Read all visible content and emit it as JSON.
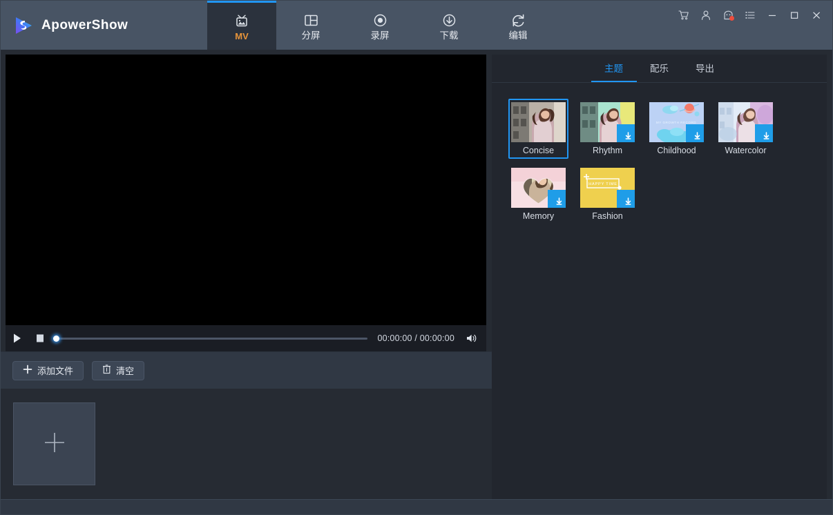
{
  "app": {
    "brand_name": "ApowerShow",
    "logo_icon": "play-logo-icon"
  },
  "nav": {
    "tabs": [
      {
        "label": "MV",
        "icon": "tv-icon",
        "active": true
      },
      {
        "label": "分屏",
        "icon": "split-screen-icon",
        "active": false
      },
      {
        "label": "录屏",
        "icon": "record-icon",
        "active": false
      },
      {
        "label": "下载",
        "icon": "download-icon",
        "active": false
      },
      {
        "label": "编辑",
        "icon": "edit-refresh-icon",
        "active": false
      }
    ]
  },
  "window_controls": [
    {
      "name": "cart-icon",
      "badge": false
    },
    {
      "name": "account-icon",
      "badge": false
    },
    {
      "name": "message-icon",
      "badge": true
    },
    {
      "name": "menu-list-icon",
      "badge": false
    },
    {
      "name": "minimize-icon",
      "badge": false
    },
    {
      "name": "maximize-icon",
      "badge": false
    },
    {
      "name": "close-icon",
      "badge": false
    }
  ],
  "player": {
    "play_icon": "play-icon",
    "stop_icon": "stop-icon",
    "volume_icon": "volume-icon",
    "progress_percent": 0,
    "current_time": "00:00:00",
    "total_time": "00:00:00",
    "timecode": "00:00:00 / 00:00:00"
  },
  "actions": {
    "add_file_label": "添加文件",
    "add_file_icon": "plus-icon",
    "clear_label": "清空",
    "clear_icon": "trash-icon"
  },
  "timeline": {
    "add_tile_icon": "plus-icon",
    "items": []
  },
  "right_panel": {
    "tabs": [
      {
        "label": "主题",
        "active": true
      },
      {
        "label": "配乐",
        "active": false
      },
      {
        "label": "导出",
        "active": false
      }
    ],
    "themes": [
      {
        "name": "Concise",
        "selected": true,
        "downloadable": false,
        "style": "photo-street"
      },
      {
        "name": "Rhythm",
        "selected": false,
        "downloadable": true,
        "style": "photo-mint"
      },
      {
        "name": "Childhood",
        "selected": false,
        "downloadable": true,
        "style": "sky-clouds",
        "caption": "MY GROWTH RECORD"
      },
      {
        "name": "Watercolor",
        "selected": false,
        "downloadable": true,
        "style": "photo-violet"
      },
      {
        "name": "Memory",
        "selected": false,
        "downloadable": true,
        "style": "photo-heart"
      },
      {
        "name": "Fashion",
        "selected": false,
        "downloadable": true,
        "style": "yellow-frame",
        "caption": "HAPPY TIME"
      }
    ]
  },
  "colors": {
    "header_bg": "#485464",
    "panel_bg": "#262b33",
    "right_panel_bg": "#22262e",
    "accent_blue": "#2196f3",
    "accent_orange": "#e8953a",
    "badge_red": "#ef4d3d",
    "preview_bg": "#000000"
  }
}
